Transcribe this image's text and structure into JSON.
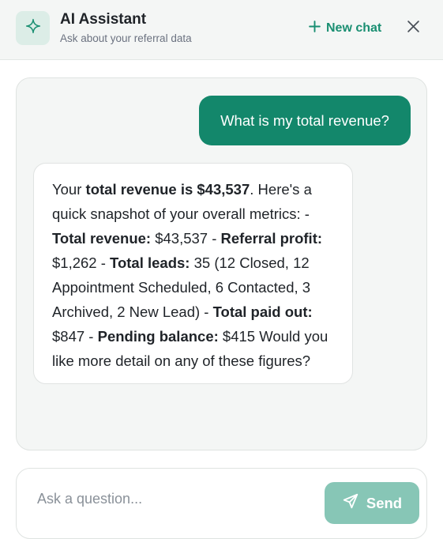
{
  "header": {
    "title": "AI Assistant",
    "subtitle": "Ask about your referral data",
    "new_chat_label": "New chat",
    "logo_icon": "sparkle-icon",
    "new_chat_icon": "plus-icon",
    "close_icon": "close-icon"
  },
  "messages": {
    "user": "What is my total revenue?",
    "assistant": {
      "p1": "Your ",
      "b1": "total revenue is $43,537",
      "p2": ". Here's a quick snapshot of your overall metrics: - ",
      "b2": "Total revenue:",
      "p3": " $43,537 - ",
      "b3": "Referral profit:",
      "p4": " $1,262 - ",
      "b4": "Total leads:",
      "p5": " 35 (12 Closed, 12 Appointment Scheduled, 6 Contacted, 3 Archived, 2 New Lead) - ",
      "b5": "Total paid out:",
      "p6": " $847 - ",
      "b6": "Pending balance:",
      "p7": " $415 Would you like more detail on any of these figures?"
    }
  },
  "composer": {
    "placeholder": "Ask a question...",
    "value": "",
    "send_label": "Send",
    "send_icon": "paper-plane-icon"
  },
  "colors": {
    "accent": "#13876b",
    "accent_text": "#1a8f72",
    "send_disabled": "#87c6b6",
    "panel_bg": "#f4f6f5",
    "logo_bg": "#dcede7"
  }
}
